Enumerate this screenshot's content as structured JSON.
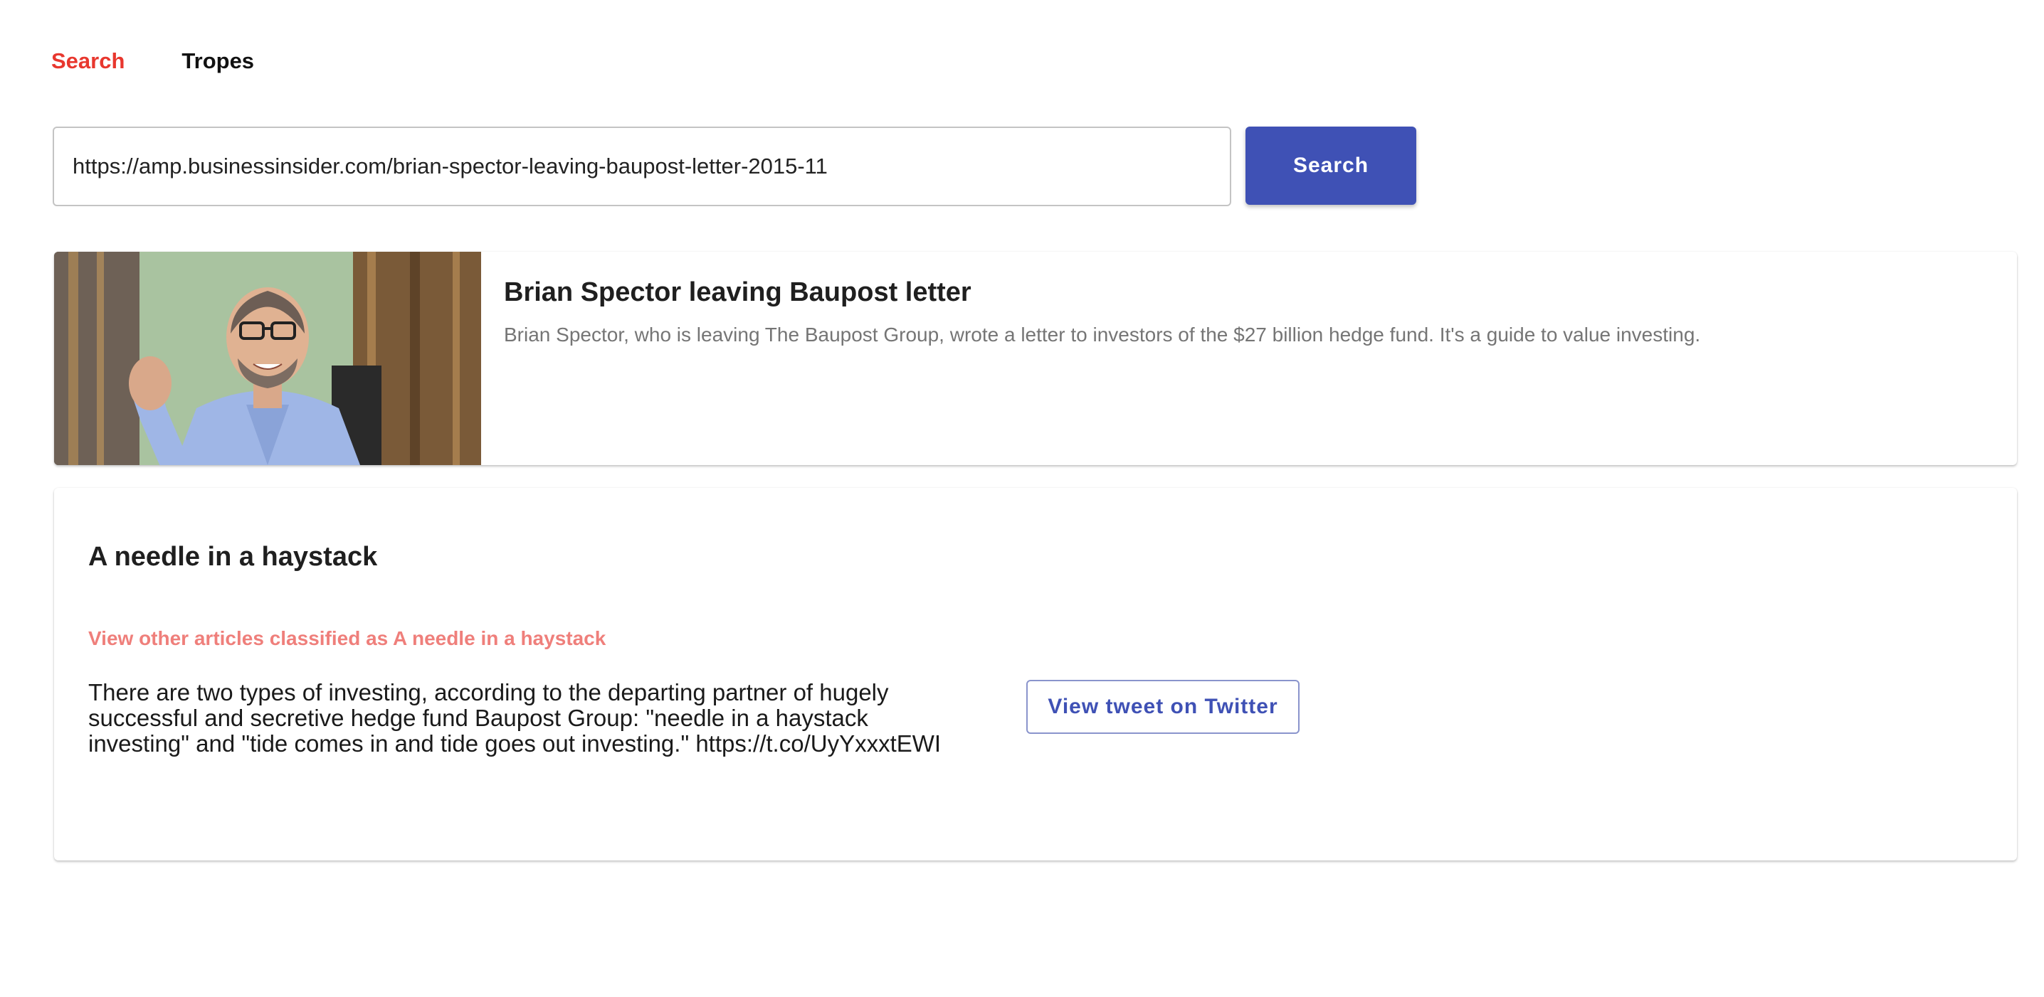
{
  "nav": {
    "search_label": "Search",
    "tropes_label": "Tropes"
  },
  "search": {
    "value": "https://amp.businessinsider.com/brian-spector-leaving-baupost-letter-2015-11",
    "button_label": "Search"
  },
  "article": {
    "title": "Brian Spector leaving Baupost letter",
    "description": "Brian Spector, who is leaving The Baupost Group, wrote a letter to investors of the $27 billion hedge fund. It's a guide to value investing."
  },
  "trope": {
    "title": "A needle in a haystack",
    "link_label": "View other articles classified as A needle in a haystack",
    "tweet_text": "There are two types of investing, according to the departing partner of hugely successful and secretive hedge fund Baupost Group: \"needle in a haystack investing\" and \"tide comes in and tide goes out investing.\" https://t.co/UyYxxxtEWI",
    "tweet_button_label": "View tweet on Twitter"
  },
  "colors": {
    "accent_red": "#e8372e",
    "primary_blue": "#3f51b5",
    "link_pink": "#ef7f7b"
  }
}
